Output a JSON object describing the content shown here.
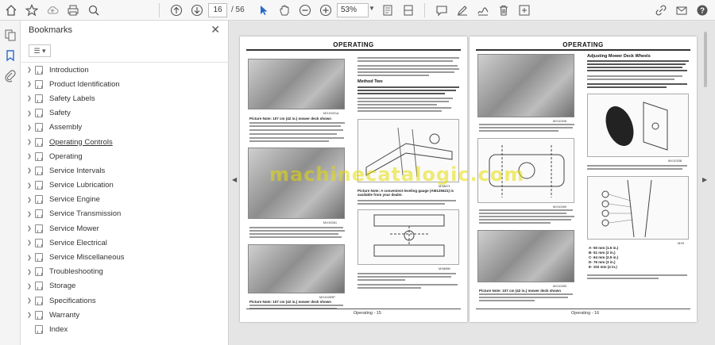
{
  "toolbar": {
    "page_current": "16",
    "page_total": "/ 56",
    "zoom": "53%"
  },
  "panel": {
    "title": "Bookmarks",
    "items": [
      {
        "label": "Introduction",
        "expandable": true
      },
      {
        "label": "Product Identification",
        "expandable": true
      },
      {
        "label": "Safety Labels",
        "expandable": true
      },
      {
        "label": "Safety",
        "expandable": true
      },
      {
        "label": "Assembly",
        "expandable": true
      },
      {
        "label": "Operating Controls",
        "expandable": true,
        "current": true
      },
      {
        "label": "Operating",
        "expandable": true
      },
      {
        "label": "Service Intervals",
        "expandable": true
      },
      {
        "label": "Service Lubrication",
        "expandable": true
      },
      {
        "label": "Service Engine",
        "expandable": true
      },
      {
        "label": "Service Transmission",
        "expandable": true
      },
      {
        "label": "Service Mower",
        "expandable": true
      },
      {
        "label": "Service Electrical",
        "expandable": true
      },
      {
        "label": "Service Miscellaneous",
        "expandable": true
      },
      {
        "label": "Troubleshooting",
        "expandable": true
      },
      {
        "label": "Storage",
        "expandable": true
      },
      {
        "label": "Specifications",
        "expandable": true
      },
      {
        "label": "Warranty",
        "expandable": true
      },
      {
        "label": "Index",
        "expandable": false
      }
    ]
  },
  "document": {
    "left_page": {
      "header": "OPERATING",
      "footer": "Operating - 15",
      "method_two": "Method Two",
      "caption1": "Picture Note: 107 cm (42 in.) mower deck shown",
      "caption2": "Picture Note: 107 cm (42 in.) mower deck shown",
      "caption3": "Picture Note: A convenient leveling gauge (AM125621) is available from your dealer.",
      "figure_ids": [
        "MX19201a",
        "MX19261",
        "MX10283P",
        "MX8871",
        "MX8880"
      ]
    },
    "right_page": {
      "header": "OPERATING",
      "footer": "Operating - 16",
      "section": "Adjusting Mower Deck Wheels",
      "caption": "Picture Note: 107 cm (42 in.) mower deck shown",
      "wheel_specs": [
        "A- 50 mm (1.5 in.)",
        "B- 51 mm (2 in.)",
        "C- 64 mm (2.5 in.)",
        "D- 76 mm (3 in.)",
        "E- 102 mm (4 in.)"
      ],
      "figure_ids": [
        "MX10206",
        "MX10269",
        "MX10283",
        "MX10338",
        "MX9"
      ]
    },
    "watermark": "machinecatalogic.com"
  }
}
